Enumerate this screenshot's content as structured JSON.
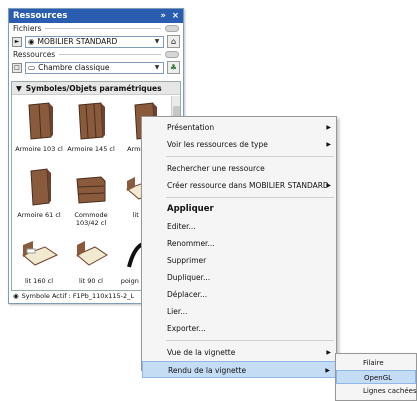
{
  "palette": {
    "title": "Ressources",
    "title_controls": [
      "»",
      "×"
    ],
    "fichiers_label": "Fichiers",
    "fichiers_value": "MOBILIER STANDARD",
    "ressources_label": "Ressources",
    "ressources_value": "Chambre classique",
    "library_header": "Symboles/Objets paramétriques",
    "items": [
      {
        "label": "Armoire 103 cl",
        "icon": "armoire-thumb"
      },
      {
        "label": "Armoire 145 cl",
        "icon": "armoire-thumb"
      },
      {
        "label": "Armoire 2",
        "icon": "armoire-thumb"
      },
      {
        "label": "Armoire 61 cl",
        "icon": "armoire-thumb"
      },
      {
        "label": "Commode 103/42 cl",
        "icon": "commode-thumb"
      },
      {
        "label": "lit 140",
        "icon": "lit-thumb"
      },
      {
        "label": "lit 160 cl",
        "icon": "lit-thumb"
      },
      {
        "label": "lit 90 cl",
        "icon": "lit-thumb"
      },
      {
        "label": "poign meuble",
        "icon": "poignee-thumb"
      }
    ],
    "status": "Symbole Actif : F1Pb_110x115-2_L"
  },
  "menu": {
    "items": [
      {
        "label": "Présentation",
        "submenu": true
      },
      {
        "label": "Voir les ressources de type",
        "submenu": true
      },
      {
        "sep": true
      },
      {
        "label": "Rechercher une ressource"
      },
      {
        "label": "Créer ressource dans  MOBILIER STANDARD",
        "submenu": true
      },
      {
        "sep": true
      },
      {
        "label": "Appliquer",
        "bold": true
      },
      {
        "label": "Editer..."
      },
      {
        "label": "Renommer..."
      },
      {
        "label": "Supprimer"
      },
      {
        "label": "Dupliquer..."
      },
      {
        "label": "Déplacer..."
      },
      {
        "label": "Lier..."
      },
      {
        "label": "Exporter..."
      },
      {
        "sep": true
      },
      {
        "label": "Vue de la vignette",
        "submenu": true
      },
      {
        "label": "Rendu de la vignette",
        "submenu": true,
        "highlight": true
      }
    ]
  },
  "submenu": {
    "items": [
      {
        "label": "Filaire"
      },
      {
        "label": "OpenGL",
        "highlight": true
      },
      {
        "label": "Lignes cachées"
      }
    ]
  },
  "colors": {
    "title_bar": "#2a5db0",
    "highlight": "#c5dcf5",
    "wood": "#8a5a3c"
  }
}
